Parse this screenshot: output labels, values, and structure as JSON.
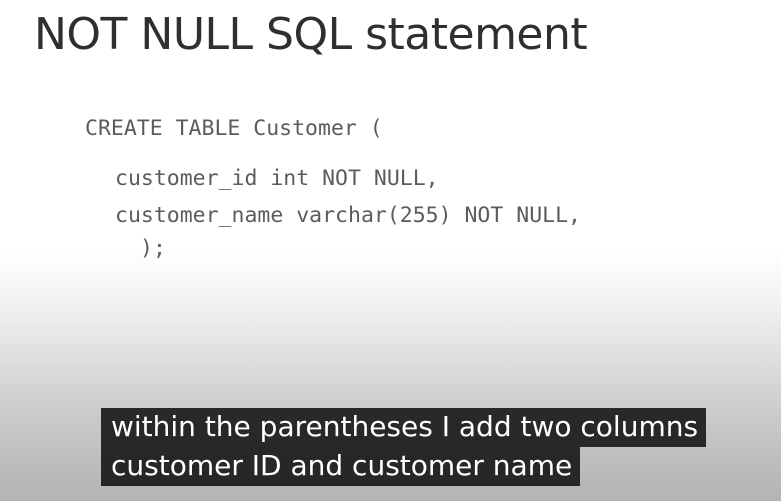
{
  "slide": {
    "title": "NOT NULL SQL statement"
  },
  "code": {
    "lines": [
      "CREATE TABLE Customer (",
      "customer_id int NOT NULL,",
      "customer_name varchar(255) NOT NULL,",
      ");"
    ]
  },
  "captions": {
    "lines": [
      "within the parentheses I add two columns",
      "customer ID and customer name"
    ]
  },
  "colors": {
    "title_text": "#2f2f2f",
    "code_text": "#5c5c5c",
    "caption_background": "#121212",
    "caption_text": "#ffffff"
  }
}
